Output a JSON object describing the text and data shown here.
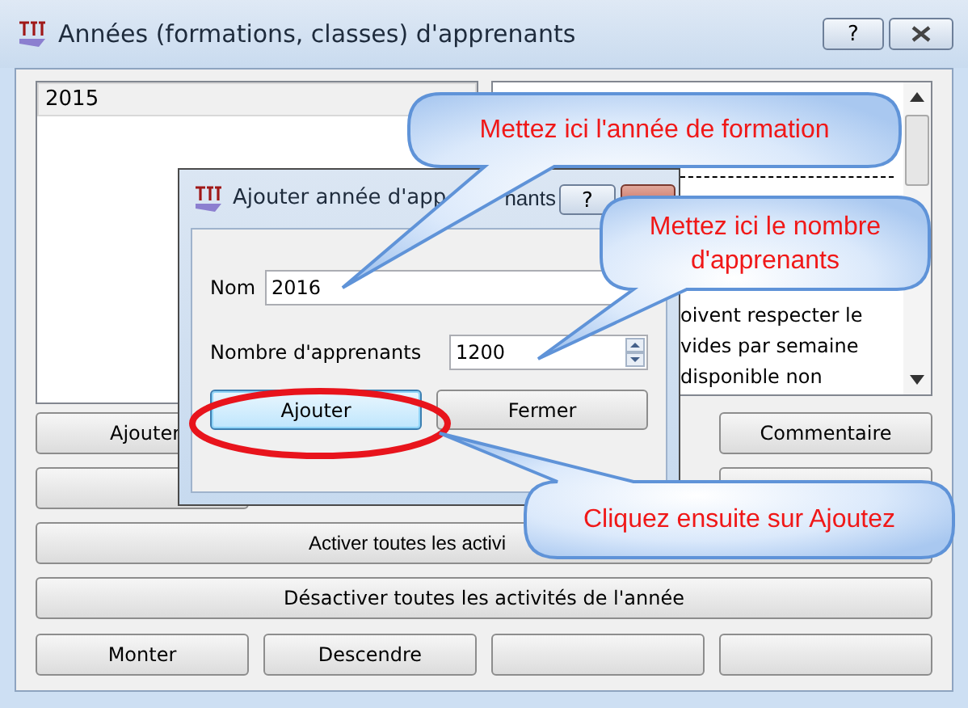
{
  "window": {
    "title": "Années (formations, classes) d'apprenants",
    "help": "?"
  },
  "list": {
    "items": [
      {
        "label": "2015",
        "selected": true
      }
    ]
  },
  "notes": {
    "lines": [
      "oivent respecter le",
      "vides par semaine",
      "disponible non"
    ]
  },
  "buttons": {
    "row_1": [
      "Ajouter",
      "Commentaire"
    ],
    "activate": "Activer toutes les activi",
    "deactivate": "Désactiver toutes les activités de l'année",
    "row_5": [
      "Monter",
      "Descendre"
    ]
  },
  "dialog": {
    "title": "Ajouter année d'app",
    "title_tail": "nants",
    "help": "?",
    "name_label": "Nom",
    "name_value": "2016",
    "count_label": "Nombre d'apprenants",
    "count_value": "1200",
    "buttons": [
      {
        "label": "Ajouter",
        "focused": true
      },
      {
        "label": "Fermer",
        "focused": false
      }
    ]
  },
  "callouts": [
    {
      "text": "Mettez ici l'année de formation"
    },
    {
      "text": "Mettez ici le nombre d'apprenants"
    },
    {
      "text": "Cliquez ensuite sur Ajoutez"
    }
  ]
}
